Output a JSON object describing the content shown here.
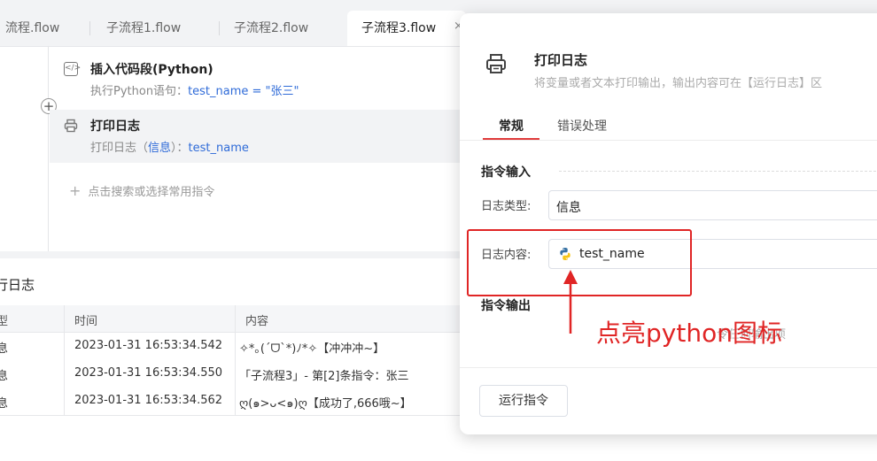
{
  "tabs": [
    {
      "label": "流程.flow"
    },
    {
      "label": "子流程1.flow"
    },
    {
      "label": "子流程2.flow"
    },
    {
      "label": "子流程3.flow"
    }
  ],
  "tab_close": "×",
  "steps": [
    {
      "title": "插入代码段(Python)",
      "desc_prefix": "执行Python语句：",
      "desc_code": "test_name = \"张三\""
    },
    {
      "title": "打印日志",
      "desc_prefix": "打印日志（",
      "desc_type": "信息",
      "desc_mid": "）：",
      "desc_var": "test_name"
    }
  ],
  "add_button": "+",
  "add_hint": "点击搜索或选择常用指令",
  "add_hint_plus": "+",
  "log": {
    "title": "行日志",
    "columns": [
      "型",
      "时间",
      "内容"
    ],
    "rows": [
      {
        "type": "息",
        "time": "2023-01-31 16:53:34.542",
        "content": "✧*｡(ˊᗜˋ*)ﾉ*✧【冲冲冲~】"
      },
      {
        "type": "息",
        "time": "2023-01-31 16:53:34.550",
        "content": "「子流程3」- 第[2]条指令：张三"
      },
      {
        "type": "息",
        "time": "2023-01-31 16:53:34.562",
        "content": "ღ(๑>ᴗ<๑)ღ【成功了,666哦~】"
      }
    ]
  },
  "dialog": {
    "title": "打印日志",
    "subtitle": "将变量或者文本打印输出，输出内容可在【运行日志】区",
    "tabs": [
      "常规",
      "错误处理"
    ],
    "input_section": "指令输入",
    "fields": [
      {
        "label": "日志类型:",
        "value": "信息"
      },
      {
        "label": "日志内容:",
        "value": "test_name"
      }
    ],
    "output_section": "指令输出",
    "output_hint": "令任何输出项",
    "run_button": "运行指令"
  },
  "annotation": {
    "text": "点亮python图标",
    "color": "#e02525"
  },
  "colors": {
    "accent": "#2f6bd8",
    "active_tab_underline": "#e03a3a"
  }
}
